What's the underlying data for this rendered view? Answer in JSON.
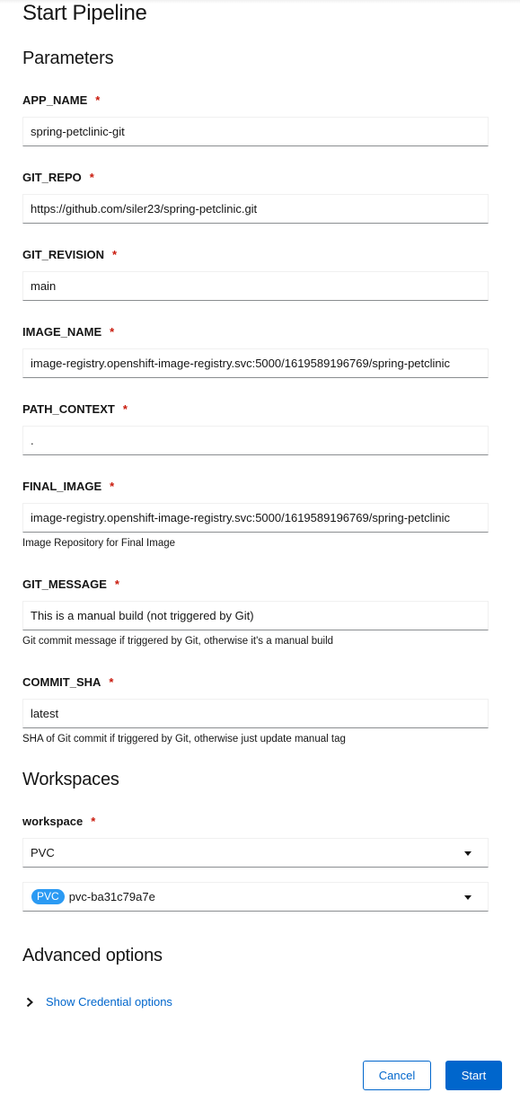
{
  "page": {
    "title": "Start Pipeline"
  },
  "sections": {
    "parameters": "Parameters",
    "workspaces": "Workspaces",
    "advanced": "Advanced options"
  },
  "required_mark": "*",
  "params": [
    {
      "label": "APP_NAME",
      "value": "spring-petclinic-git",
      "helper": ""
    },
    {
      "label": "GIT_REPO",
      "value": "https://github.com/siler23/spring-petclinic.git",
      "helper": ""
    },
    {
      "label": "GIT_REVISION",
      "value": "main",
      "helper": ""
    },
    {
      "label": "IMAGE_NAME",
      "value": "image-registry.openshift-image-registry.svc:5000/1619589196769/spring-petclinic",
      "helper": ""
    },
    {
      "label": "PATH_CONTEXT",
      "value": ".",
      "helper": ""
    },
    {
      "label": "FINAL_IMAGE",
      "value": "image-registry.openshift-image-registry.svc:5000/1619589196769/spring-petclinic",
      "helper": "Image Repository for Final Image"
    },
    {
      "label": "GIT_MESSAGE",
      "value": "This is a manual build (not triggered by Git)",
      "helper": "Git commit message if triggered by Git, otherwise it's a manual build"
    },
    {
      "label": "COMMIT_SHA",
      "value": "latest",
      "helper": "SHA of Git commit if triggered by Git, otherwise just update manual tag"
    }
  ],
  "workspace": {
    "label": "workspace",
    "type_value": "PVC",
    "pvc_badge": "PVC",
    "pvc_name": "pvc-ba31c79a7e"
  },
  "advanced": {
    "link": "Show Credential options"
  },
  "actions": {
    "cancel": "Cancel",
    "start": "Start"
  },
  "colors": {
    "accent": "#0066cc",
    "required": "#c9190b",
    "badge": "#2b9af3"
  }
}
